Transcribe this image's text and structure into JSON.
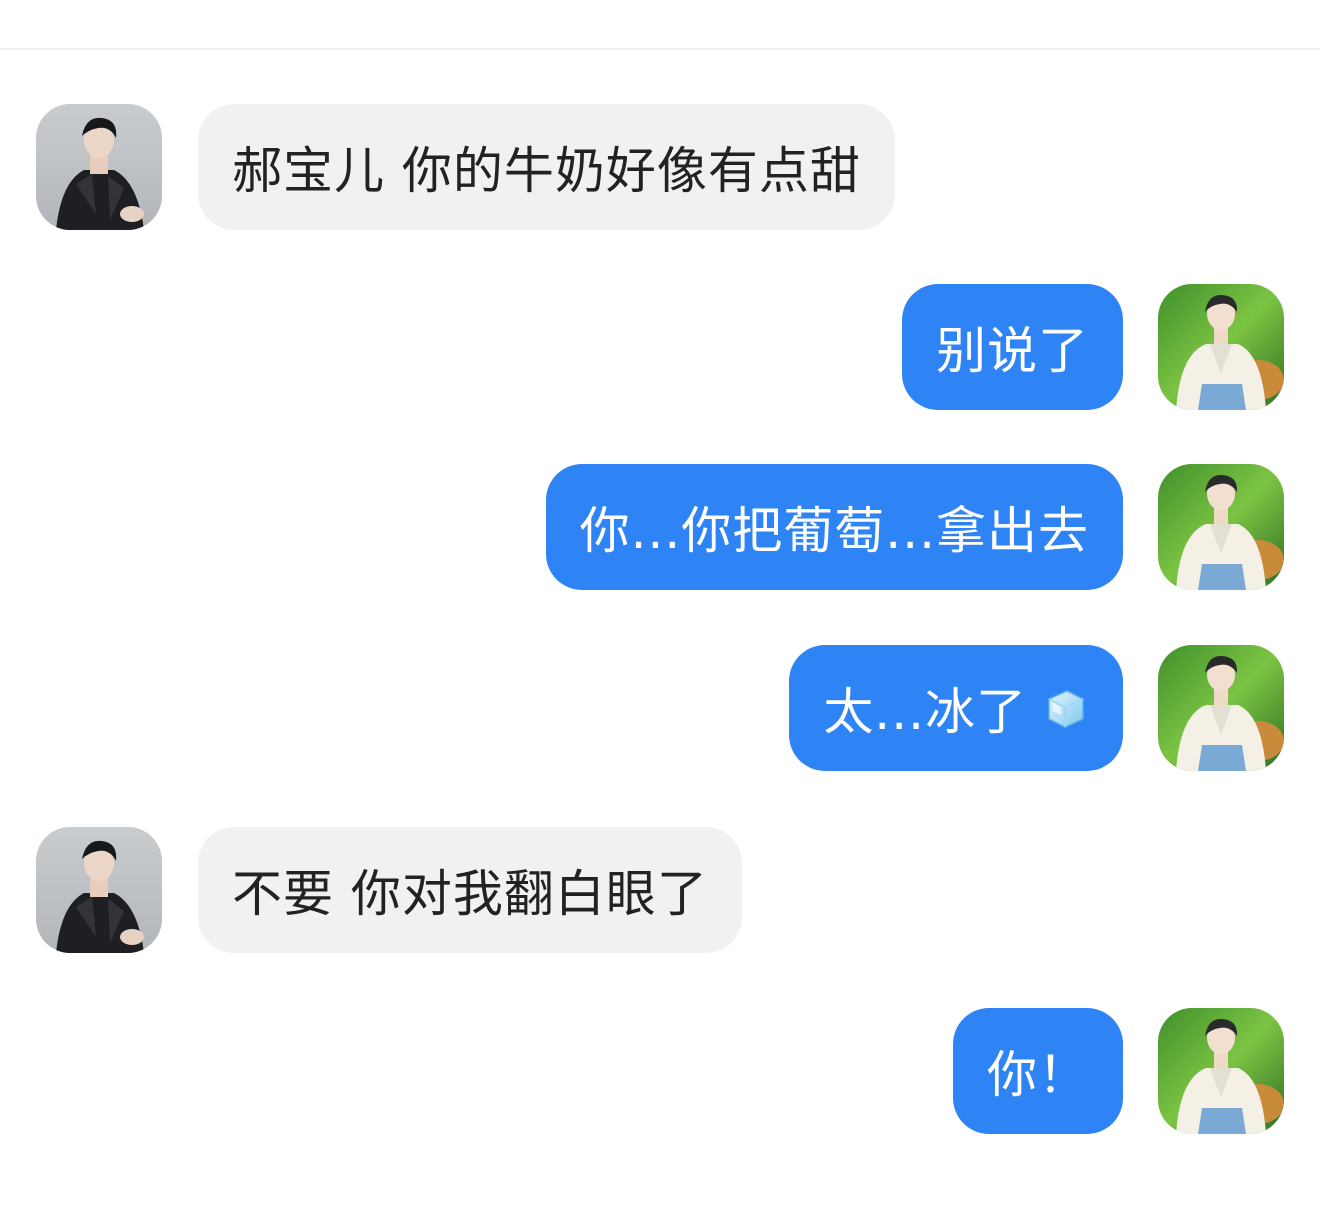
{
  "messages": [
    {
      "side": "in",
      "text": "郝宝儿 你的牛奶好像有点甜"
    },
    {
      "side": "out",
      "text": "别说了"
    },
    {
      "side": "out",
      "text": "你...你把葡萄...拿出去"
    },
    {
      "side": "out",
      "text": "太...冰了",
      "emoji": "ice-cube-icon"
    },
    {
      "side": "in",
      "text": "不要 你对我翻白眼了"
    },
    {
      "side": "out",
      "text": "你！"
    }
  ],
  "colors": {
    "incoming_bubble": "#f1f1f1",
    "outgoing_bubble": "#2f84f5",
    "incoming_text": "#222222",
    "outgoing_text": "#ffffff"
  },
  "avatars": {
    "incoming": "avatar-dark-suit",
    "outgoing": "avatar-white-shirt-green-background"
  }
}
